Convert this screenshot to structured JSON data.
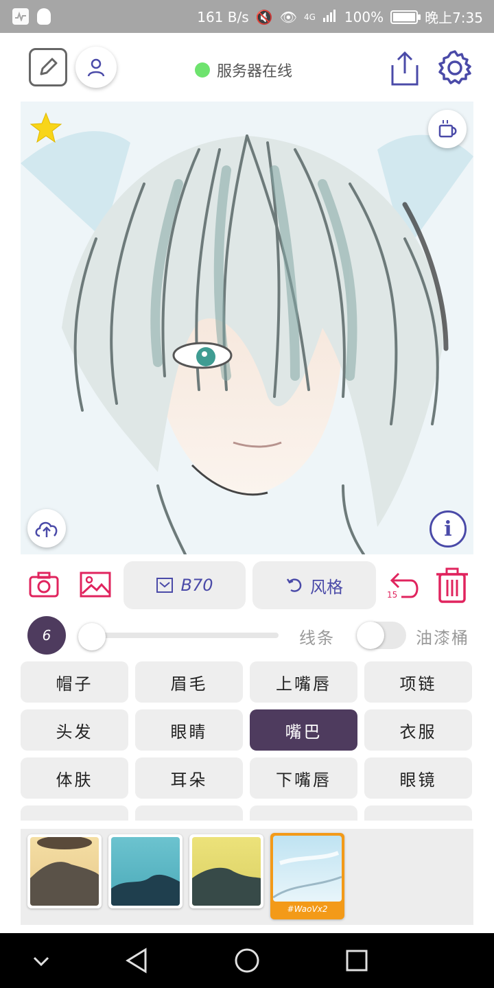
{
  "status_bar": {
    "net_speed": "161 B/s",
    "network": "4G",
    "battery": "100%",
    "time": "晚上7:35",
    "battery_level": 1.0
  },
  "toolbar": {
    "server_status": "服务器在线",
    "server_status_color": "#6ee36e",
    "icons": [
      "edit-icon",
      "user-icon",
      "share-icon",
      "settings-icon"
    ],
    "accent": "#4a4aa8"
  },
  "canvas": {
    "corner_icons": [
      "star-icon",
      "coffee-cup-icon",
      "cloud-upload-icon",
      "info-icon"
    ]
  },
  "actions": {
    "b_label": "B70",
    "style_label": "风格",
    "undo_count": "15",
    "accent": "#e0245e"
  },
  "slider_row": {
    "brush_size": "6",
    "line_label": "线条",
    "bucket_label": "油漆桶",
    "slider_level": 0.0,
    "bucket_enabled": false
  },
  "parts": [
    "帽子",
    "眉毛",
    "上嘴唇",
    "项链",
    "头发",
    "眼睛",
    "嘴巴",
    "衣服",
    "体肤",
    "耳朵",
    "下嘴唇",
    "眼镜"
  ],
  "selected_part": "嘴巴",
  "style_strip": {
    "selected_label": "#WaoVx2"
  }
}
